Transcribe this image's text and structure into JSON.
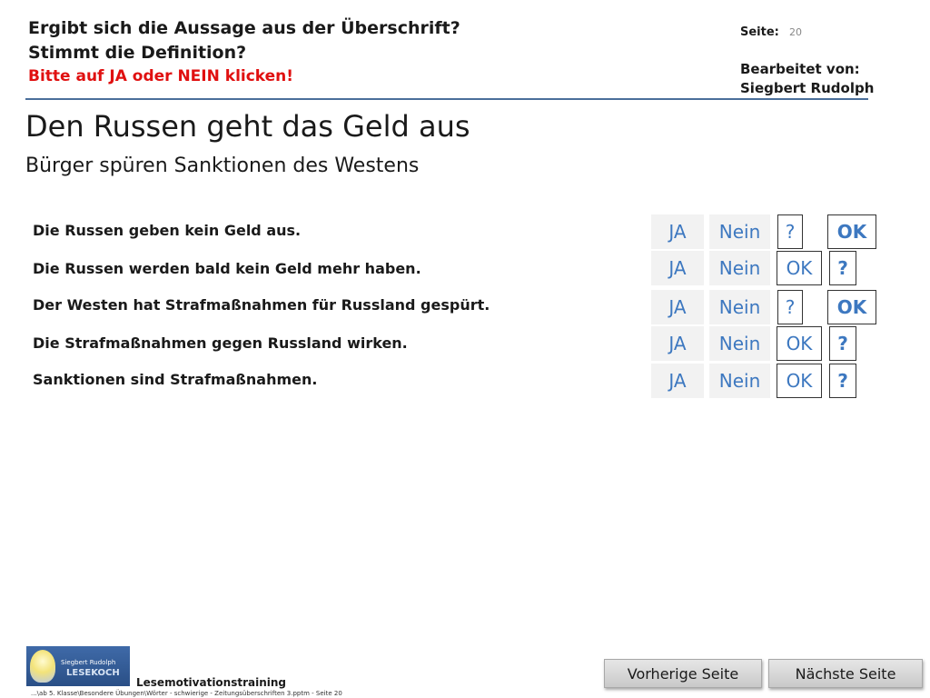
{
  "header": {
    "question_1": "Ergibt sich die Aussage aus der Überschrift?",
    "question_2": "Stimmt die Definition?",
    "instruction": "Bitte auf JA oder NEIN klicken!",
    "page_label": "Seite:",
    "page_number": "20",
    "edited_by_label": "Bearbeitet von:",
    "edited_by_name": "Siegbert Rudolph"
  },
  "article": {
    "headline": "Den Russen geht das Geld aus",
    "subheadline": "Bürger spüren Sanktionen des Westens"
  },
  "statements": [
    {
      "text": "Die Russen geben kein Geld aus.",
      "ja": "JA",
      "nein": "Nein",
      "fb_a": "?",
      "fb_b": "OK"
    },
    {
      "text": "Die Russen werden bald kein Geld mehr haben.",
      "ja": "JA",
      "nein": "Nein",
      "fb_a": "OK",
      "fb_b": "?"
    },
    {
      "text": "Der Westen hat Strafmaßnahmen für Russland gespürt.",
      "ja": "JA",
      "nein": "Nein",
      "fb_a": "?",
      "fb_b": "OK"
    },
    {
      "text": "Die Strafmaßnahmen gegen Russland wirken.",
      "ja": "JA",
      "nein": "Nein",
      "fb_a": "OK",
      "fb_b": "?"
    },
    {
      "text": "Sanktionen sind Strafmaßnahmen.",
      "ja": "JA",
      "nein": "Nein",
      "fb_a": "OK",
      "fb_b": "?"
    }
  ],
  "footer": {
    "logo_line_1": "Siegbert Rudolph",
    "logo_line_2": "LESEKOCH",
    "title": "Lesemotivationstraining",
    "path": "...\\ab 5. Klasse\\Besondere Übungen\\Wörter - schwierige - Zeitungsüberschriften 3.pptm - Seite 20",
    "prev_button": "Vorherige Seite",
    "next_button": "Nächste Seite"
  },
  "colors": {
    "accent_blue": "#3d78c0",
    "instruction_red": "#e01010",
    "divider": "#4a6f9a"
  }
}
